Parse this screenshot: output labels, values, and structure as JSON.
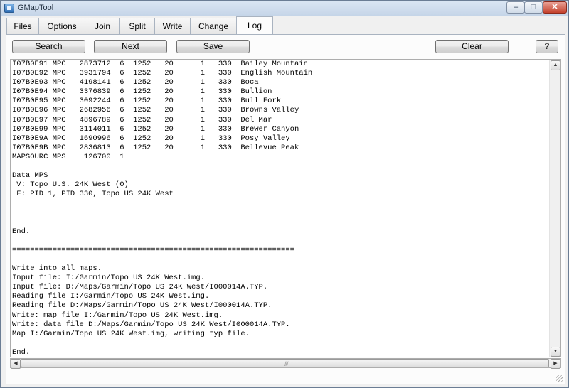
{
  "window": {
    "title": "GMapTool"
  },
  "tabs": [
    "Files",
    "Options",
    "Join",
    "Split",
    "Write",
    "Change",
    "Log"
  ],
  "active_tab": "Log",
  "toolbar": {
    "search_label": "Search",
    "next_label": "Next",
    "save_label": "Save",
    "clear_label": "Clear",
    "help_label": "?"
  },
  "log": {
    "text": "I07B0E91 MPC   2873712  6  1252   20      1   330  Bailey Mountain\nI07B0E92 MPC   3931794  6  1252   20      1   330  English Mountain\nI07B0E93 MPC   4198141  6  1252   20      1   330  Boca\nI07B0E94 MPC   3376839  6  1252   20      1   330  Bullion\nI07B0E95 MPC   3092244  6  1252   20      1   330  Bull Fork\nI07B0E96 MPC   2682956  6  1252   20      1   330  Browns Valley\nI07B0E97 MPC   4896789  6  1252   20      1   330  Del Mar\nI07B0E99 MPC   3114011  6  1252   20      1   330  Brewer Canyon\nI07B0E9A MPC   1690996  6  1252   20      1   330  Posy Valley\nI07B0E9B MPC   2836813  6  1252   20      1   330  Bellevue Peak\nMAPSOURC MPS    126700  1\n\nData MPS\n V: Topo U.S. 24K West (0)\n F: PID 1, PID 330, Topo US 24K West\n\n\n\nEnd.\n\n===============================================================\n\nWrite into all maps.\nInput file: I:/Garmin/Topo US 24K West.img.\nInput file: D:/Maps/Garmin/Topo US 24K West/I000014A.TYP.\nReading file I:/Garmin/Topo US 24K West.img.\nReading file D:/Maps/Garmin/Topo US 24K West/I000014A.TYP.\nWrite: map file I:/Garmin/Topo US 24K West.img.\nWrite: data file D:/Maps/Garmin/Topo US 24K West/I000014A.TYP.\nMap I:/Garmin/Topo US 24K West.img, writing typ file.\n\nEnd."
  },
  "icons": {
    "app": "map-app-icon",
    "minimize": "minimize-icon",
    "maximize": "maximize-icon",
    "close": "close-icon",
    "scroll_up": "arrow-up-icon",
    "scroll_down": "arrow-down-icon",
    "scroll_left": "arrow-left-icon",
    "scroll_right": "arrow-right-icon"
  }
}
